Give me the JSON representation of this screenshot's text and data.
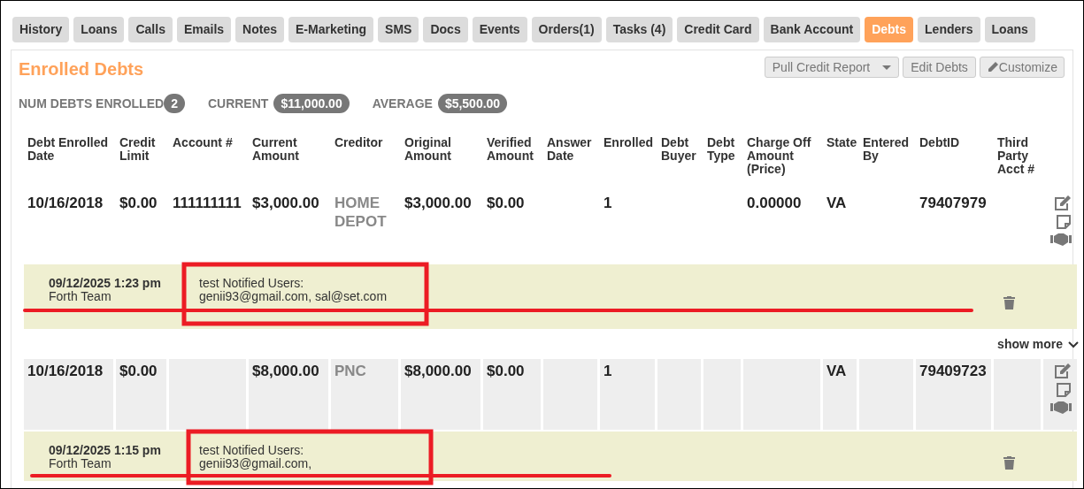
{
  "tabs": [
    {
      "label": "History",
      "selected": false
    },
    {
      "label": "Loans",
      "selected": false
    },
    {
      "label": "Calls",
      "selected": false
    },
    {
      "label": "Emails",
      "selected": false
    },
    {
      "label": "Notes",
      "selected": false
    },
    {
      "label": "E-Marketing",
      "selected": false
    },
    {
      "label": "SMS",
      "selected": false
    },
    {
      "label": "Docs",
      "selected": false
    },
    {
      "label": "Events",
      "selected": false
    },
    {
      "label": "Orders(1)",
      "selected": false
    },
    {
      "label": "Tasks (4)",
      "selected": false
    },
    {
      "label": "Credit Card",
      "selected": false
    },
    {
      "label": "Bank Account",
      "selected": false
    },
    {
      "label": "Debts",
      "selected": true
    },
    {
      "label": "Lenders",
      "selected": false
    },
    {
      "label": "Loans",
      "selected": false
    }
  ],
  "section_title": "Enrolled Debts",
  "toolbar": [
    {
      "label": "Pull Credit Report",
      "kind": "dropdown"
    },
    {
      "label": "Edit Debts",
      "kind": "plain"
    },
    {
      "label": "Customize",
      "kind": "pencil"
    }
  ],
  "summary": [
    {
      "label": "NUM DEBTS ENROLLED",
      "value": "2"
    },
    {
      "label": "CURRENT",
      "value": "$11,000.00"
    },
    {
      "label": "AVERAGE",
      "value": "$5,500.00"
    }
  ],
  "columns": [
    {
      "label": "Debt Enrolled Date",
      "kind": "text"
    },
    {
      "label": "Credit Limit",
      "kind": "text"
    },
    {
      "label": "Account #",
      "kind": "text"
    },
    {
      "label": "Current Amount",
      "kind": "text"
    },
    {
      "label": "Creditor",
      "kind": "link"
    },
    {
      "label": "Original Amount",
      "kind": "text"
    },
    {
      "label": "Verified Amount",
      "kind": "text"
    },
    {
      "label": "Answer Date",
      "kind": "text"
    },
    {
      "label": "Enrolled",
      "kind": "text"
    },
    {
      "label": "Debt Buyer",
      "kind": "text"
    },
    {
      "label": "Debt Type",
      "kind": "text"
    },
    {
      "label": "Charge Off Amount (Price)",
      "kind": "text"
    },
    {
      "label": "State",
      "kind": "text"
    },
    {
      "label": "Entered By",
      "kind": "text"
    },
    {
      "label": "DebtID",
      "kind": "text"
    },
    {
      "label": "Third Party Acct #",
      "kind": "text"
    }
  ],
  "rows": [
    {
      "shaded": false,
      "cells": [
        "10/16/2018",
        "$0.00",
        "111111111",
        "$3,000.00",
        "HOME DEPOT",
        "$3,000.00",
        "$0.00",
        null,
        "1",
        null,
        null,
        "0.00000",
        "VA",
        null,
        "79407979",
        null
      ],
      "note": {
        "date": "09/12/2025 1:23 pm",
        "author": "Forth Team",
        "text": "test Notified Users: genii93@gmail.com, sal@set.com"
      },
      "show_more": "show more"
    },
    {
      "shaded": true,
      "cells": [
        "10/16/2018",
        "$0.00",
        null,
        "$8,000.00",
        "PNC",
        "$8,000.00",
        "$0.00",
        null,
        "1",
        null,
        null,
        null,
        "VA",
        null,
        "79409723",
        null
      ],
      "note": {
        "date": "09/12/2025 1:15 pm",
        "author": "Forth Team",
        "text": "test Notified Users: genii93@gmail.com,"
      }
    }
  ]
}
